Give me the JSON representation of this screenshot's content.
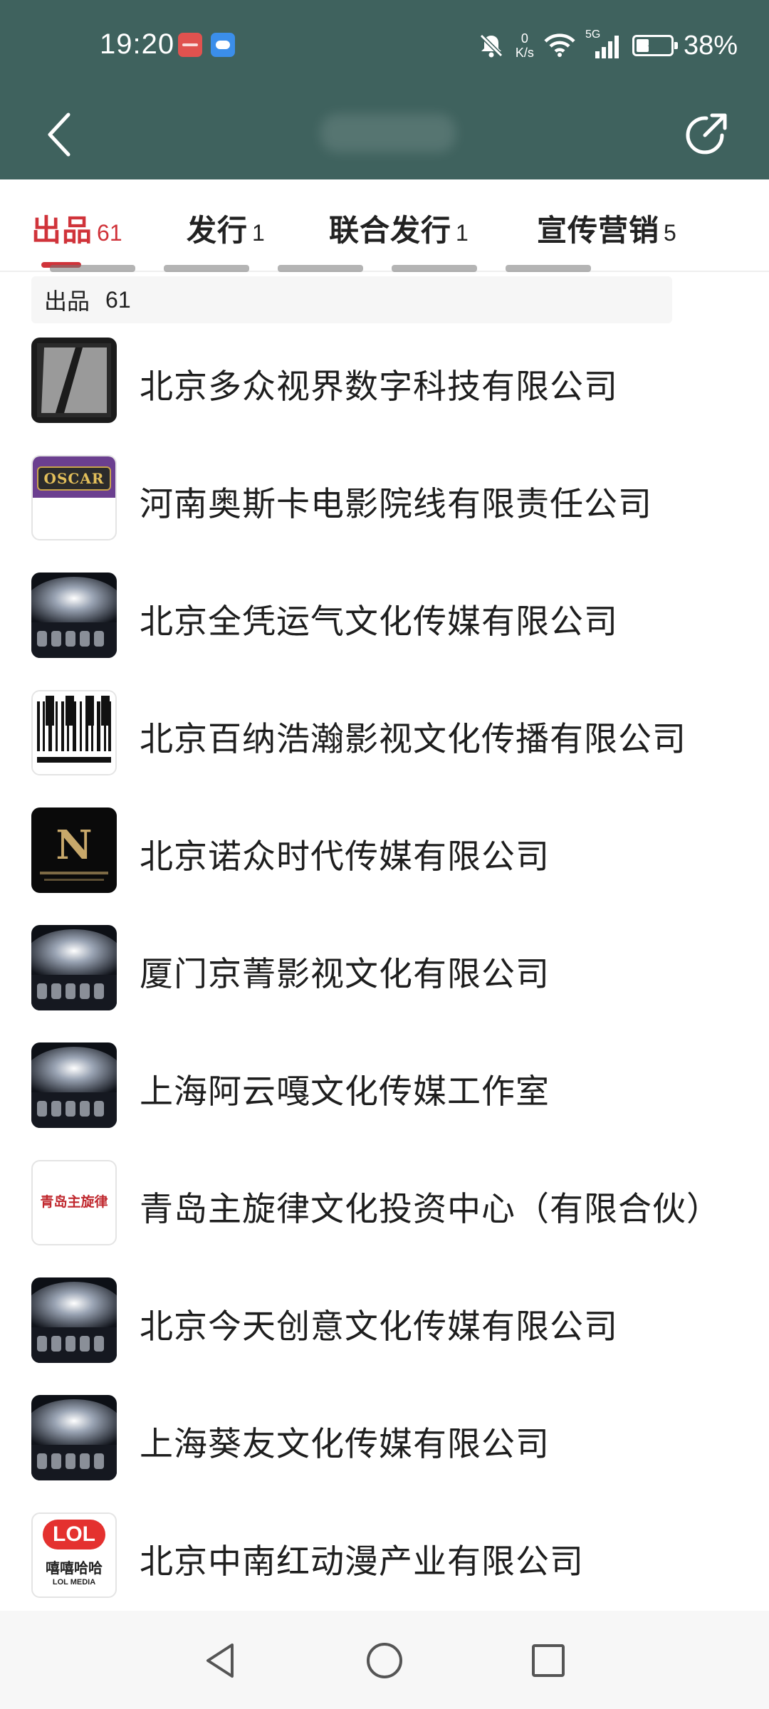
{
  "status_bar": {
    "time": "19:20",
    "net_speed_value": "0",
    "net_speed_unit": "K/s",
    "network": "5G",
    "battery_percent": "38%",
    "battery_level": 0.38,
    "icons": [
      "app-badge-red",
      "cloud-app-badge",
      "mute-bell-icon",
      "wifi-icon",
      "signal-icon",
      "battery-charging-icon"
    ]
  },
  "header": {
    "back_icon": "chevron-left-icon",
    "share_icon": "share-icon",
    "background_color": "#3f625e"
  },
  "tabs": [
    {
      "label": "出品",
      "count": "61",
      "active": true
    },
    {
      "label": "发行",
      "count": "1",
      "active": false
    },
    {
      "label": "联合发行",
      "count": "1",
      "active": false
    },
    {
      "label": "宣传营销",
      "count": "5",
      "active": false
    }
  ],
  "accent_color": "#d0333a",
  "section": {
    "name": "出品",
    "count": "61"
  },
  "companies": [
    {
      "name": "北京多众视界数字科技有限公司",
      "logo": "slash-logo"
    },
    {
      "name": "河南奥斯卡电影院线有限责任公司",
      "logo": "oscar-logo",
      "logo_text": "OSCAR"
    },
    {
      "name": "北京全凭运气文化传媒有限公司",
      "logo": "cinema-placeholder-logo"
    },
    {
      "name": "北京百纳浩瀚影视文化传播有限公司",
      "logo": "piano-keys-logo"
    },
    {
      "name": "北京诺众时代传媒有限公司",
      "logo": "letter-n-logo",
      "logo_text": "N"
    },
    {
      "name": "厦门京菁影视文化有限公司",
      "logo": "cinema-placeholder-logo"
    },
    {
      "name": "上海阿云嘎文化传媒工作室",
      "logo": "cinema-placeholder-logo"
    },
    {
      "name": "青岛主旋律文化投资中心（有限合伙）",
      "logo": "qingdao-text-logo",
      "logo_text": "青岛主旋律"
    },
    {
      "name": "北京今天创意文化传媒有限公司",
      "logo": "cinema-placeholder-logo"
    },
    {
      "name": "上海葵友文化传媒有限公司",
      "logo": "cinema-placeholder-logo"
    },
    {
      "name": "北京中南红动漫产业有限公司",
      "logo": "lol-media-logo",
      "logo_text": "LOL",
      "logo_subtext": "嘻嘻哈哈",
      "logo_caption": "LOL MEDIA"
    }
  ],
  "nav_bar": {
    "back": "triangle-back-icon",
    "home": "circle-home-icon",
    "recents": "square-recents-icon"
  }
}
